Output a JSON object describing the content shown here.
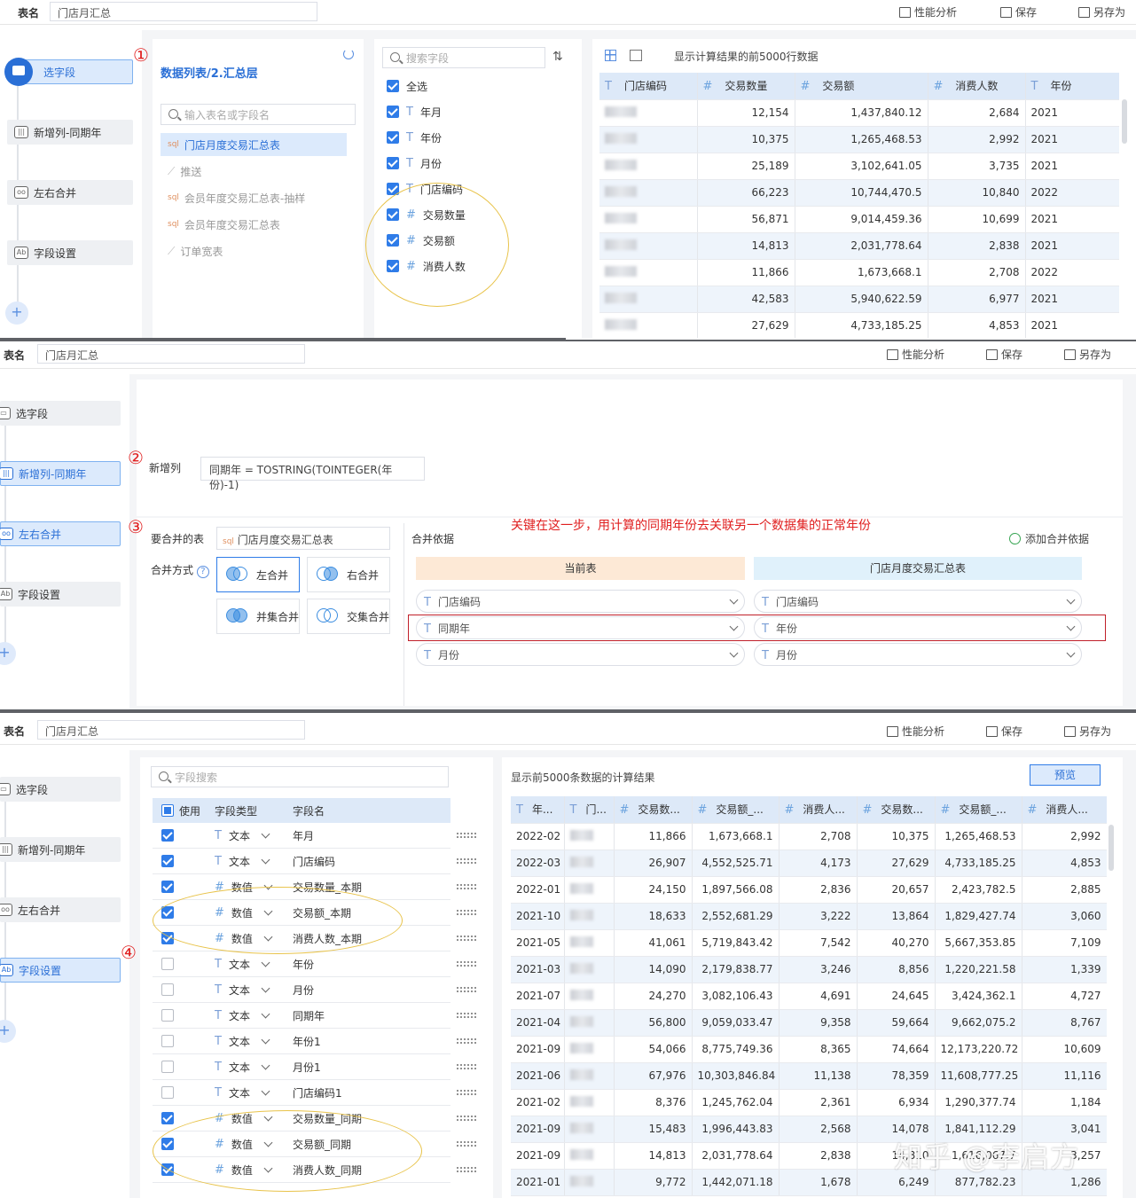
{
  "topbar": {
    "table_label": "表名",
    "table_name": "门店月汇总",
    "perf": "性能分析",
    "save": "保存",
    "save_as": "另存为"
  },
  "steps": {
    "select": "选字段",
    "new_col": "新增列-同期年",
    "merge": "左右合并",
    "field_set": "字段设置"
  },
  "annotations": {
    "n1": "①",
    "n2": "②",
    "n3": "③",
    "n4": "④",
    "key_note": "关键在这一步，用计算的同期年份去关联另一个数据集的正常年份"
  },
  "panel1": {
    "breadcrumb": "数据列表/2.汇总层",
    "table_search_placeholder": "输入表名或字段名",
    "sources": [
      {
        "label": "门店月度交易汇总表",
        "type": "sql"
      },
      {
        "label": "推送",
        "type": "chart"
      },
      {
        "label": "会员年度交易汇总表-抽样",
        "type": "sql"
      },
      {
        "label": "会员年度交易汇总表",
        "type": "sql"
      },
      {
        "label": "订单宽表",
        "type": "chart"
      }
    ],
    "field_search_placeholder": "搜索字段",
    "select_all": "全选",
    "fields": [
      {
        "type": "T",
        "name": "年月"
      },
      {
        "type": "T",
        "name": "年份"
      },
      {
        "type": "T",
        "name": "月份"
      },
      {
        "type": "T",
        "name": "门店编码"
      },
      {
        "type": "#",
        "name": "交易数量"
      },
      {
        "type": "#",
        "name": "交易额"
      },
      {
        "type": "#",
        "name": "消费人数"
      }
    ],
    "preview_note": "显示计算结果的前5000行数据",
    "columns": [
      {
        "type": "T",
        "name": "门店编码"
      },
      {
        "type": "#",
        "name": "交易数量"
      },
      {
        "type": "#",
        "name": "交易额"
      },
      {
        "type": "#",
        "name": "消费人数"
      },
      {
        "type": "T",
        "name": "年份"
      }
    ],
    "rows": [
      [
        "12,154",
        "1,437,840.12",
        "2,684",
        "2021"
      ],
      [
        "10,375",
        "1,265,468.53",
        "2,992",
        "2021"
      ],
      [
        "25,189",
        "3,102,641.05",
        "3,735",
        "2021"
      ],
      [
        "66,223",
        "10,744,470.5",
        "10,840",
        "2022"
      ],
      [
        "56,871",
        "9,014,459.36",
        "10,699",
        "2021"
      ],
      [
        "14,813",
        "2,031,778.64",
        "2,838",
        "2021"
      ],
      [
        "11,866",
        "1,673,668.1",
        "2,708",
        "2022"
      ],
      [
        "42,583",
        "5,940,622.59",
        "6,977",
        "2021"
      ],
      [
        "27,629",
        "4,733,185.25",
        "4,853",
        "2021"
      ]
    ]
  },
  "panel2": {
    "new_col_label": "新增列",
    "formula": "同期年 = TOSTRING(TOINTEGER(年份)-1)",
    "merge_table_label": "要合并的表",
    "merge_table": "门店月度交易汇总表",
    "merge_mode_label": "合并方式",
    "help": "?",
    "modes": [
      "左合并",
      "右合并",
      "并集合并",
      "交集合并"
    ],
    "basis_label": "合并依据",
    "add_basis": "添加合并依据",
    "current_table": "当前表",
    "other_table": "门店月度交易汇总表",
    "pairs": [
      [
        "门店编码",
        "门店编码"
      ],
      [
        "同期年",
        "年份"
      ],
      [
        "月份",
        "月份"
      ]
    ]
  },
  "panel3": {
    "field_search_placeholder": "字段搜索",
    "headers": {
      "use": "使用",
      "type": "字段类型",
      "name": "字段名"
    },
    "rows": [
      {
        "on": true,
        "type": "T",
        "type_label": "文本",
        "name": "年月"
      },
      {
        "on": true,
        "type": "T",
        "type_label": "文本",
        "name": "门店编码"
      },
      {
        "on": true,
        "type": "#",
        "type_label": "数值",
        "name": "交易数量_本期"
      },
      {
        "on": true,
        "type": "#",
        "type_label": "数值",
        "name": "交易额_本期"
      },
      {
        "on": true,
        "type": "#",
        "type_label": "数值",
        "name": "消费人数_本期"
      },
      {
        "on": false,
        "type": "T",
        "type_label": "文本",
        "name": "年份"
      },
      {
        "on": false,
        "type": "T",
        "type_label": "文本",
        "name": "月份"
      },
      {
        "on": false,
        "type": "T",
        "type_label": "文本",
        "name": "同期年"
      },
      {
        "on": false,
        "type": "T",
        "type_label": "文本",
        "name": "年份1"
      },
      {
        "on": false,
        "type": "T",
        "type_label": "文本",
        "name": "月份1"
      },
      {
        "on": false,
        "type": "T",
        "type_label": "文本",
        "name": "门店编码1"
      },
      {
        "on": true,
        "type": "#",
        "type_label": "数值",
        "name": "交易数量_同期"
      },
      {
        "on": true,
        "type": "#",
        "type_label": "数值",
        "name": "交易额_同期"
      },
      {
        "on": true,
        "type": "#",
        "type_label": "数值",
        "name": "消费人数_同期"
      }
    ],
    "preview_note": "显示前5000条数据的计算结果",
    "preview_btn": "预览",
    "columns": [
      {
        "type": "T",
        "name": "年..."
      },
      {
        "type": "T",
        "name": "门..."
      },
      {
        "type": "#",
        "name": "交易数..."
      },
      {
        "type": "#",
        "name": "交易额_..."
      },
      {
        "type": "#",
        "name": "消费人..."
      },
      {
        "type": "#",
        "name": "交易数..."
      },
      {
        "type": "#",
        "name": "交易额_..."
      },
      {
        "type": "#",
        "name": "消费人..."
      }
    ],
    "data": [
      [
        "2022-02",
        "11,866",
        "1,673,668.1",
        "2,708",
        "10,375",
        "1,265,468.53",
        "2,992"
      ],
      [
        "2022-03",
        "26,907",
        "4,552,525.71",
        "4,173",
        "27,629",
        "4,733,185.25",
        "4,853"
      ],
      [
        "2022-01",
        "24,150",
        "1,897,566.08",
        "2,836",
        "20,657",
        "2,423,782.5",
        "2,885"
      ],
      [
        "2021-10",
        "18,633",
        "2,552,681.29",
        "3,222",
        "13,864",
        "1,829,427.74",
        "3,060"
      ],
      [
        "2021-05",
        "41,061",
        "5,719,843.42",
        "7,542",
        "40,270",
        "5,667,353.85",
        "7,109"
      ],
      [
        "2021-03",
        "14,090",
        "2,179,838.77",
        "3,246",
        "8,856",
        "1,220,221.58",
        "1,339"
      ],
      [
        "2021-07",
        "24,270",
        "3,082,106.43",
        "4,691",
        "24,645",
        "3,424,362.1",
        "4,727"
      ],
      [
        "2021-04",
        "56,800",
        "9,059,033.47",
        "9,358",
        "59,664",
        "9,662,075.2",
        "8,767"
      ],
      [
        "2021-09",
        "54,066",
        "8,775,749.36",
        "8,365",
        "74,664",
        "12,173,220.72",
        "10,609"
      ],
      [
        "2021-06",
        "67,976",
        "10,303,846.84",
        "11,138",
        "78,359",
        "11,608,777.25",
        "11,116"
      ],
      [
        "2021-02",
        "8,376",
        "1,245,762.04",
        "2,361",
        "6,934",
        "1,290,377.74",
        "1,184"
      ],
      [
        "2021-09",
        "15,483",
        "1,996,443.83",
        "2,568",
        "14,078",
        "1,841,112.29",
        "3,041"
      ],
      [
        "2021-09",
        "14,813",
        "2,031,778.64",
        "2,838",
        "14,810",
        "1,616,067.7",
        "3,257"
      ],
      [
        "2021-01",
        "9,772",
        "1,442,071.18",
        "1,678",
        "6,249",
        "877,782.23",
        "1,286"
      ]
    ]
  },
  "watermark": "知乎 @李启方",
  "colors": {
    "accent": "#2f7ce8",
    "annotation": "#e02020",
    "highlight_box": "#c0202a"
  }
}
